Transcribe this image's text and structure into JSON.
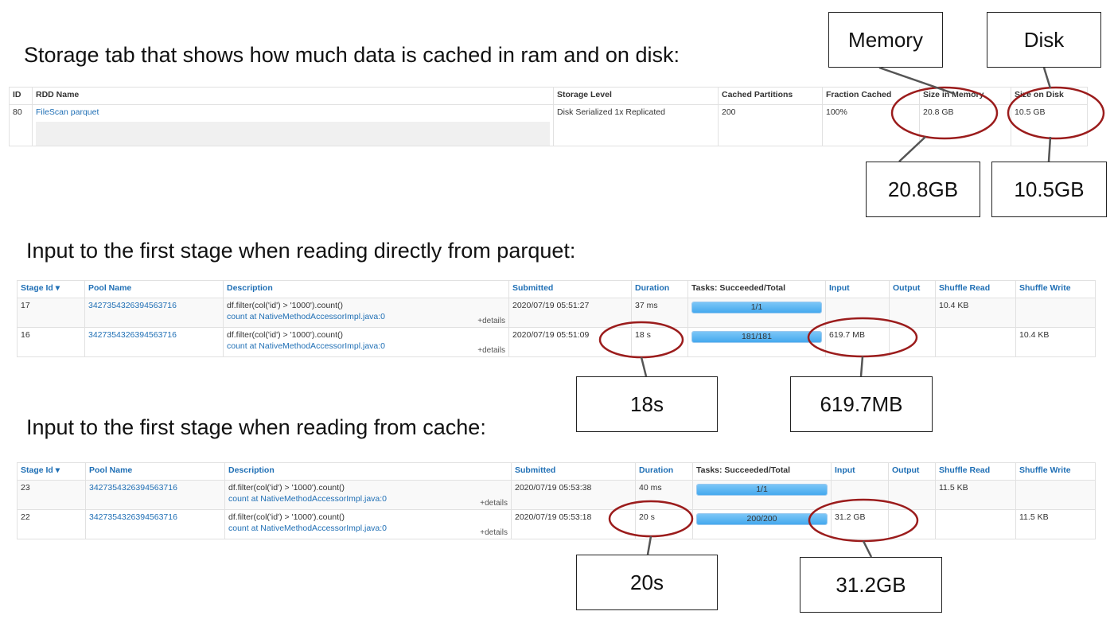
{
  "storage": {
    "heading": "Storage tab that shows how much data is cached in ram and on disk:",
    "headers": [
      "ID",
      "RDD Name",
      "Storage Level",
      "Cached Partitions",
      "Fraction Cached",
      "Size in Memory",
      "Size on Disk"
    ],
    "row": {
      "id": "80",
      "rdd_name": "FileScan parquet",
      "storage_level": "Disk Serialized 1x Replicated",
      "cached_partitions": "200",
      "fraction_cached": "100%",
      "size_in_memory": "20.8 GB",
      "size_on_disk": "10.5 GB"
    },
    "callouts": {
      "memory": "Memory",
      "disk": "Disk",
      "memory_value": "20.8GB",
      "disk_value": "10.5GB"
    }
  },
  "parquet": {
    "heading": "Input to the first stage when reading directly from parquet:",
    "headers": {
      "stage_id": "Stage Id",
      "sort_arrow": "▾",
      "pool_name": "Pool Name",
      "description": "Description",
      "submitted": "Submitted",
      "duration": "Duration",
      "tasks": "Tasks: Succeeded/Total",
      "input": "Input",
      "output": "Output",
      "shuffle_read": "Shuffle Read",
      "shuffle_write": "Shuffle Write"
    },
    "rows": [
      {
        "stage_id": "17",
        "pool_name": "3427354326394563716",
        "desc_line1": "df.filter(col('id') > '1000').count()",
        "desc_line2": "count at NativeMethodAccessorImpl.java:0",
        "details": "+details",
        "submitted": "2020/07/19 05:51:27",
        "duration": "37 ms",
        "tasks": "1/1",
        "tasks_fraction": 1.0,
        "input": "",
        "output": "",
        "shuffle_read": "10.4 KB",
        "shuffle_write": ""
      },
      {
        "stage_id": "16",
        "pool_name": "3427354326394563716",
        "desc_line1": "df.filter(col('id') > '1000').count()",
        "desc_line2": "count at NativeMethodAccessorImpl.java:0",
        "details": "+details",
        "submitted": "2020/07/19 05:51:09",
        "duration": "18 s",
        "tasks": "181/181",
        "tasks_fraction": 1.0,
        "input": "619.7 MB",
        "output": "",
        "shuffle_read": "",
        "shuffle_write": "10.4 KB"
      }
    ],
    "callouts": {
      "duration": "18s",
      "input": "619.7MB"
    }
  },
  "cache": {
    "heading": "Input to the first stage when reading from cache:",
    "headers": {
      "stage_id": "Stage Id",
      "sort_arrow": "▾",
      "pool_name": "Pool Name",
      "description": "Description",
      "submitted": "Submitted",
      "duration": "Duration",
      "tasks": "Tasks: Succeeded/Total",
      "input": "Input",
      "output": "Output",
      "shuffle_read": "Shuffle Read",
      "shuffle_write": "Shuffle Write"
    },
    "rows": [
      {
        "stage_id": "23",
        "pool_name": "3427354326394563716",
        "desc_line1": "df.filter(col('id') > '1000').count()",
        "desc_line2": "count at NativeMethodAccessorImpl.java:0",
        "details": "+details",
        "submitted": "2020/07/19 05:53:38",
        "duration": "40 ms",
        "tasks": "1/1",
        "tasks_fraction": 1.0,
        "input": "",
        "output": "",
        "shuffle_read": "11.5 KB",
        "shuffle_write": ""
      },
      {
        "stage_id": "22",
        "pool_name": "3427354326394563716",
        "desc_line1": "df.filter(col('id') > '1000').count()",
        "desc_line2": "count at NativeMethodAccessorImpl.java:0",
        "details": "+details",
        "submitted": "2020/07/19 05:53:18",
        "duration": "20 s",
        "tasks": "200/200",
        "tasks_fraction": 1.0,
        "input": "31.2 GB",
        "output": "",
        "shuffle_read": "",
        "shuffle_write": "11.5 KB"
      }
    ],
    "callouts": {
      "duration": "20s",
      "input": "31.2GB"
    }
  },
  "colors": {
    "annotation": "#9b1c1c",
    "link": "#1f6fb5",
    "progress": "#45a9ee"
  }
}
